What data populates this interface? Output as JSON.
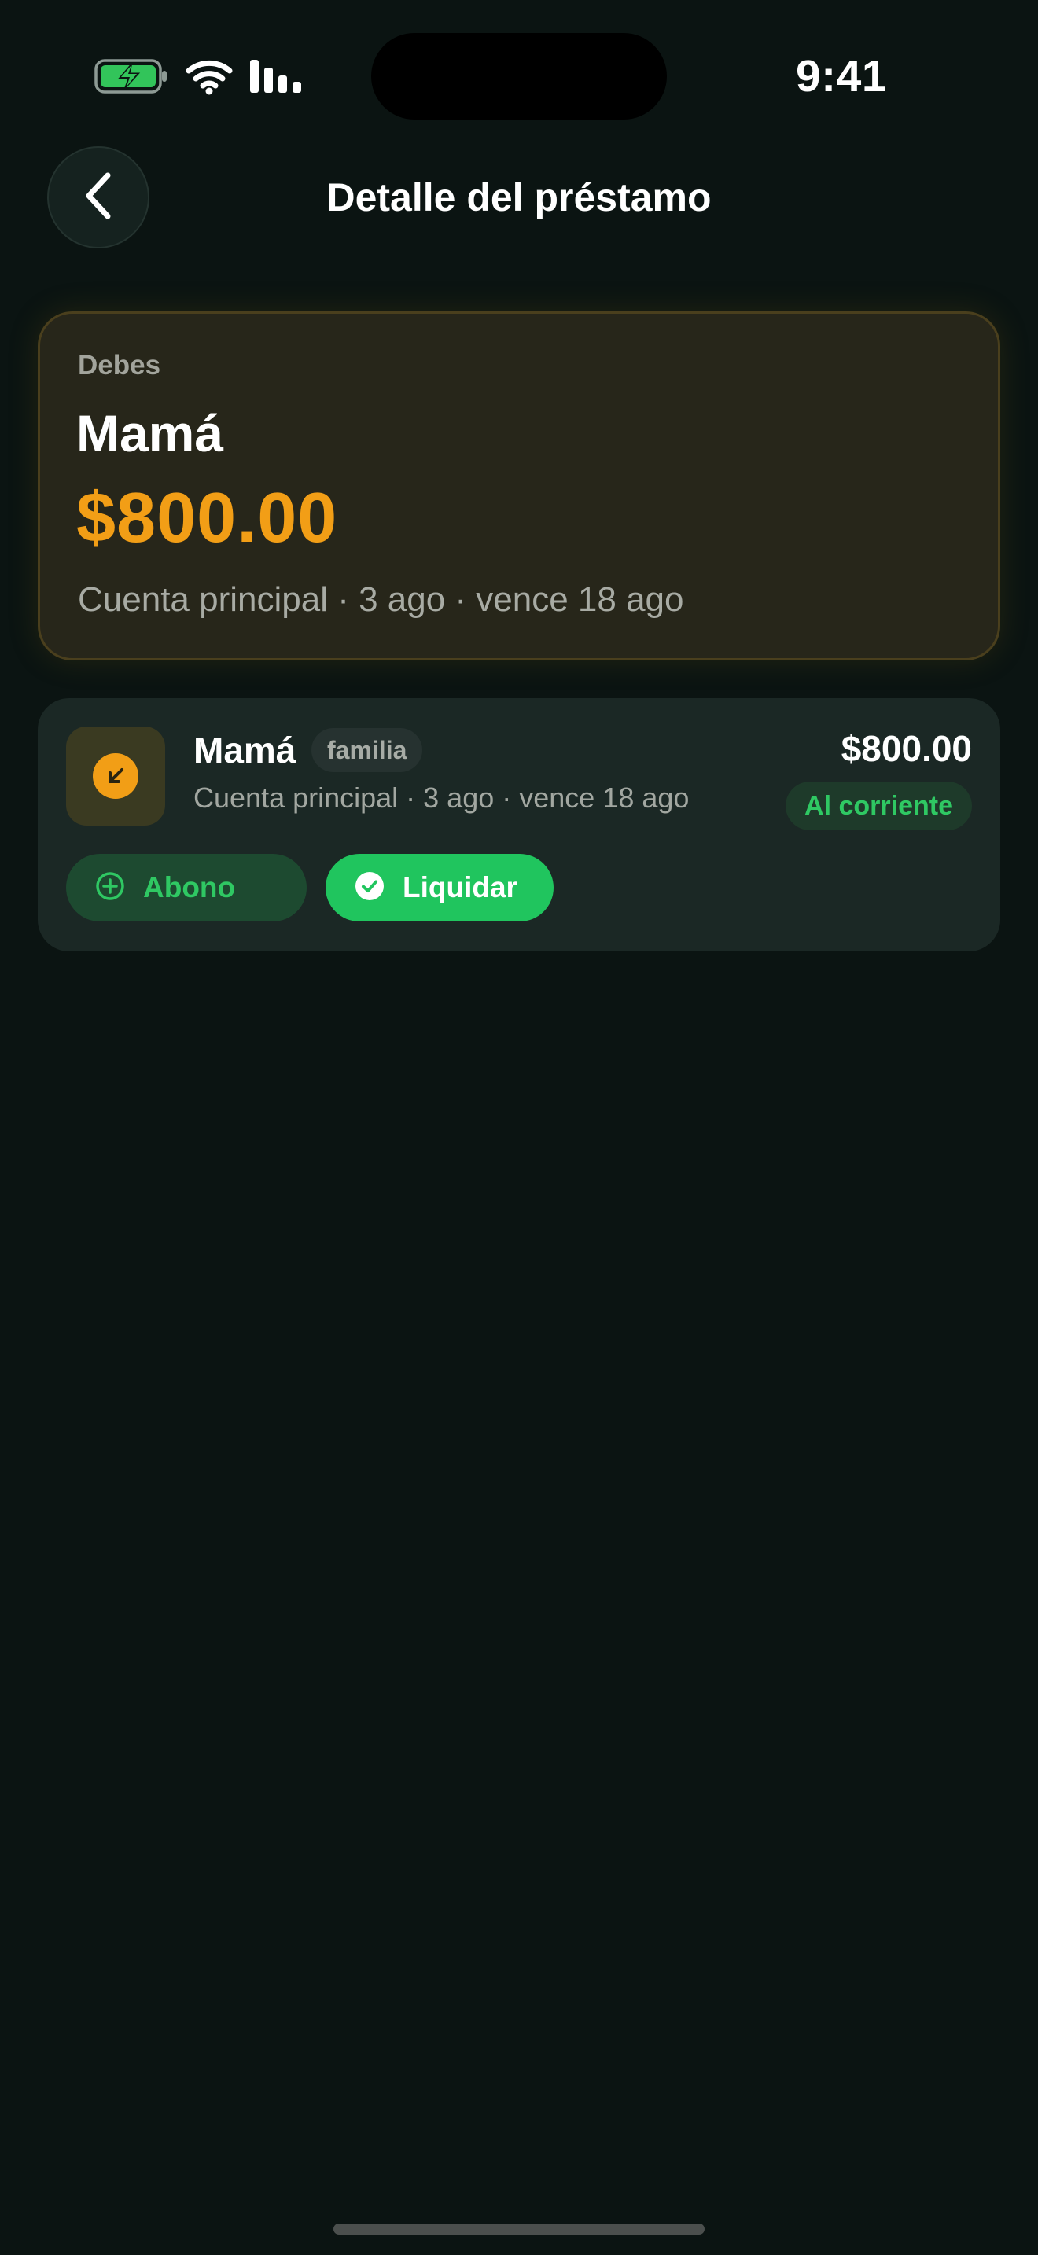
{
  "status_bar": {
    "time": "9:41",
    "icons": [
      "battery-charging-icon",
      "wifi-icon",
      "signal-icon"
    ],
    "battery_color": "#32c45a"
  },
  "header": {
    "title": "Detalle del préstamo",
    "back_icon": "chevron-left-icon"
  },
  "hero": {
    "kicker": "Debes",
    "name": "Mamá",
    "amount": "$800.00",
    "meta": "Cuenta principal · 3 ago · vence 18 ago",
    "amount_color": "#f29e16"
  },
  "loan": {
    "icon": "arrow-down-left-icon",
    "name": "Mamá",
    "tag": "familia",
    "meta": "Cuenta principal · 3 ago · vence 18 ago",
    "amount": "$800.00",
    "status": "Al corriente",
    "actions": {
      "abono_label": "Abono",
      "abono_icon": "plus-circle-icon",
      "liquidar_label": "Liquidar",
      "liquidar_icon": "check-circle-icon"
    }
  },
  "colors": {
    "background": "#0b1412",
    "accent_green": "#20c55e",
    "accent_orange": "#f29e16"
  }
}
